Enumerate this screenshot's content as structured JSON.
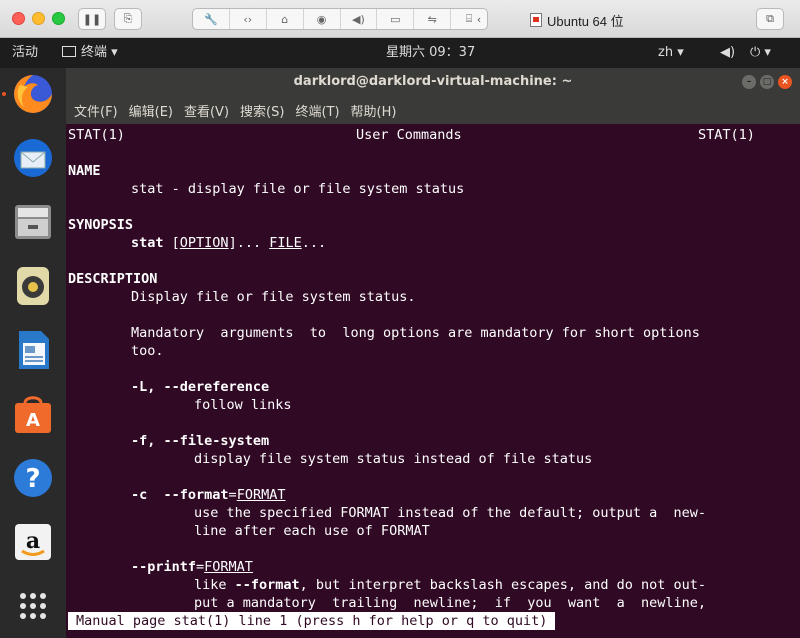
{
  "vm": {
    "title": "Ubuntu 64 位",
    "icons": [
      "pause-icon",
      "snapshot-icon",
      "wrench-icon",
      "network-icon",
      "disk-icon",
      "camera-icon",
      "sound-icon",
      "display-icon",
      "usb-icon",
      "share-folder-icon",
      "back-chevron-icon",
      "fullscreen-icon"
    ]
  },
  "topbar": {
    "activities": "活动",
    "app_menu": "终端 ▾",
    "clock": "星期六 09：37",
    "lang": "zh ▾",
    "volume_icon": "speaker-icon",
    "power": "⏻ ▾"
  },
  "dock": {
    "items": [
      "firefox-icon",
      "thunderbird-icon",
      "files-icon",
      "rhythmbox-icon",
      "libreoffice-writer-icon",
      "software-center-icon",
      "help-icon",
      "amazon-icon",
      "show-apps-icon"
    ]
  },
  "terminal": {
    "title": "darklord@darklord-virtual-machine: ~",
    "menu": [
      "文件(F)",
      "编辑(E)",
      "查看(V)",
      "搜索(S)",
      "终端(T)",
      "帮助(H)"
    ],
    "status": "Manual page stat(1) line 1 (press h for help or q to quit)"
  },
  "man": {
    "header_left": "STAT(1)",
    "header_center": "User Commands",
    "header_right": "STAT(1)",
    "name_heading": "NAME",
    "name_text": "stat - display file or file system status",
    "synopsis_heading": "SYNOPSIS",
    "syn_cmd": "stat",
    "syn_sp": " [",
    "syn_option": "OPTION",
    "syn_dots": "]... ",
    "syn_file": "FILE",
    "syn_end": "...",
    "desc_heading": "DESCRIPTION",
    "desc_1": "Display file or file system status.",
    "desc_2": "Mandatory  arguments  to  long options are mandatory for short options",
    "desc_3": "too.",
    "opt_L": "-L, --dereference",
    "opt_L_desc": "follow links",
    "opt_f": "-f, --file-system",
    "opt_f_desc": "display file system status instead of file status",
    "opt_c": "-c  --format",
    "opt_c_eq": "=",
    "opt_c_arg": "FORMAT",
    "opt_c_desc1": "use the specified FORMAT instead of the default; output a  new‐",
    "opt_c_desc2": "line after each use of FORMAT",
    "opt_p": "--printf",
    "opt_p_eq": "=",
    "opt_p_arg": "FORMAT",
    "opt_p_desc1a": "like ",
    "opt_p_desc1b": "--format",
    "opt_p_desc1c": ", but interpret backslash escapes, and do not out‐",
    "opt_p_desc2": "put a mandatory  trailing  newline;  if  you  want  a  newline,"
  }
}
